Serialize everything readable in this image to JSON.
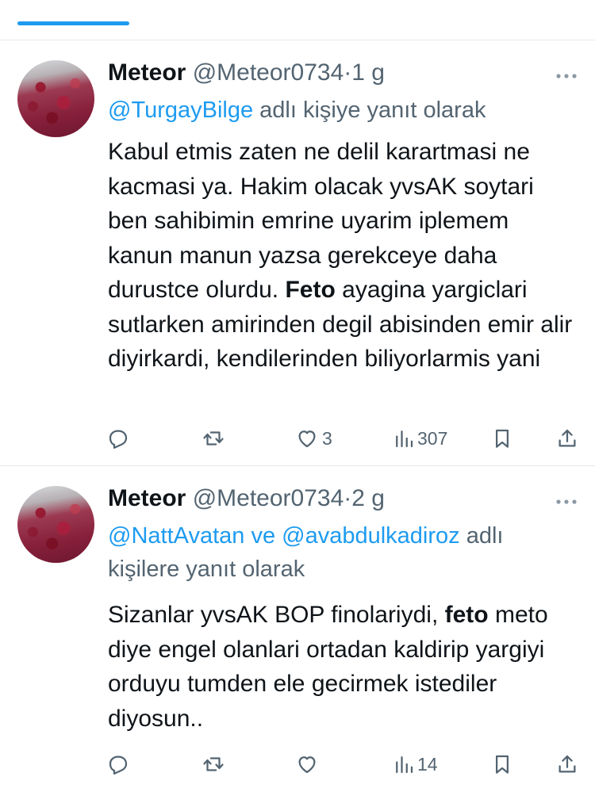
{
  "tabs": {
    "partial_labels": [
      "...",
      "...",
      "...",
      "..."
    ]
  },
  "tweets": [
    {
      "name": "Meteor",
      "handle": "@Meteor0734",
      "separator": "·",
      "time": "1 g",
      "reply_mentions": "@TurgayBilge",
      "reply_suffix": " adlı kişiye yanıt olarak",
      "text_before_bold": "Kabul etmis zaten ne delil karartmasi ne kacmasi ya. Hakim olacak yvsAK soytari ben sahibimin emrine uyarim iplemem kanun manun yazsa gerekceye daha durustce olurdu. ",
      "text_bold": "Feto",
      "text_after_bold": " ayagina yargiclari sutlarken amirinden degil abisinden emir alir diyirkardi, kendilerinden biliyorlarmis yani",
      "likes": "3",
      "views": "307",
      "more_icon": "ellipsis-icon"
    },
    {
      "name": "Meteor",
      "handle": "@Meteor0734",
      "separator": "·",
      "time": "2 g",
      "reply_mentions_1": "@NattAvatan",
      "reply_joiner": " ve ",
      "reply_mentions_2": "@avabdulkadiroz",
      "reply_suffix": " adlı kişilere yanıt olarak",
      "text_before_bold": "Sizanlar yvsAK BOP finolariydi, ",
      "text_bold": "feto",
      "text_after_bold": " meto diye engel olanlari ortadan kaldirip yargiyi orduyu tumden ele gecirmek istediler diyosun..",
      "likes": "",
      "views": "14",
      "more_icon": "ellipsis-icon"
    }
  ],
  "colors": {
    "accent": "#1d9bf0",
    "secondary_text": "#536471",
    "divider": "#e6e9ec"
  }
}
